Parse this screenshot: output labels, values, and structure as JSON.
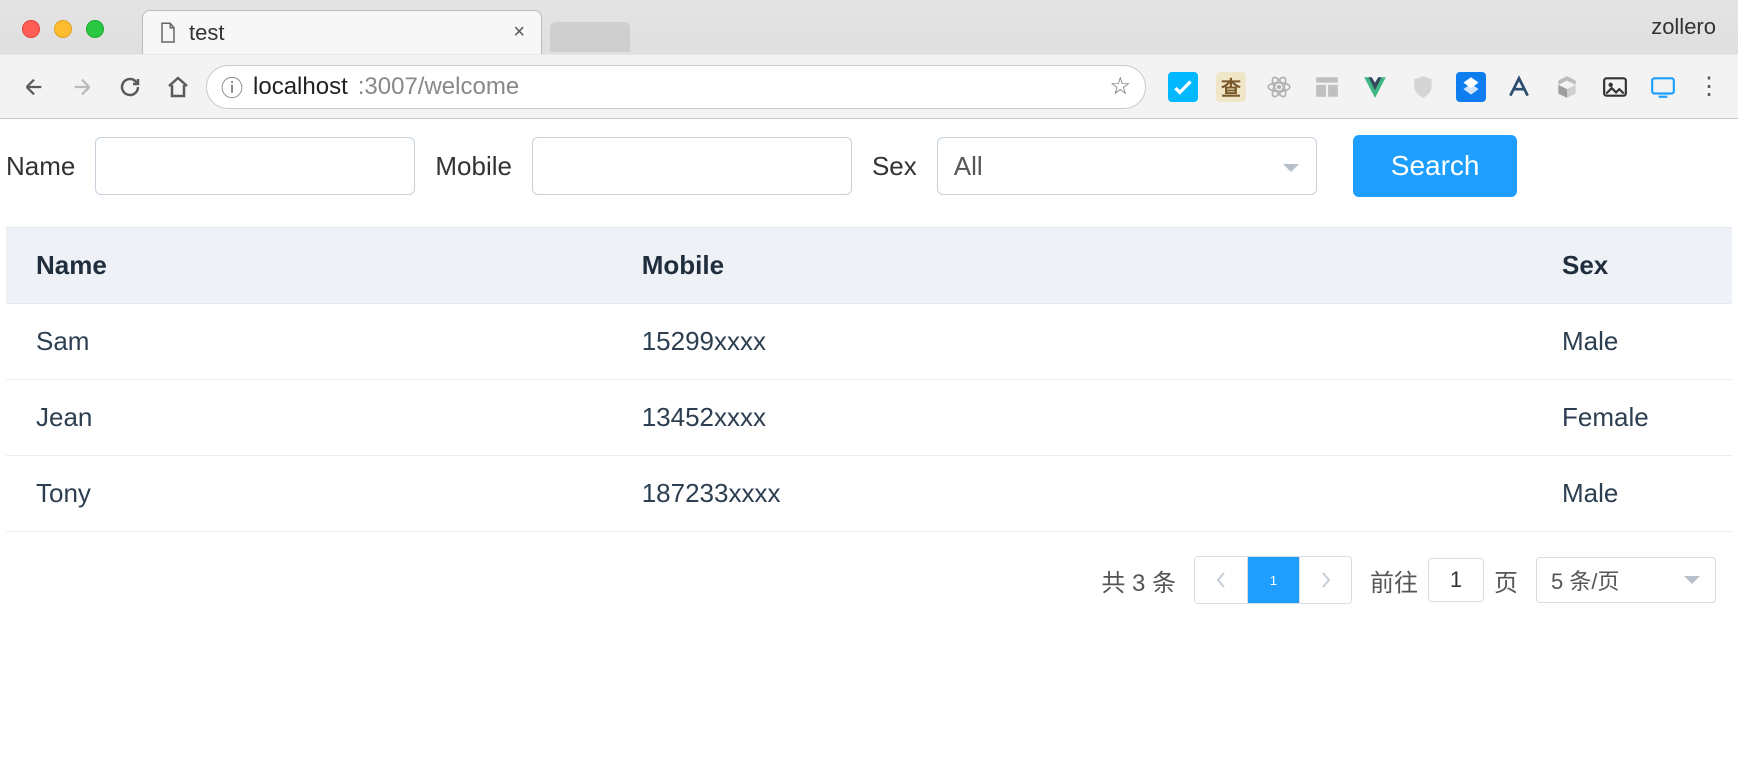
{
  "browser": {
    "tab_title": "test",
    "profile_name": "zollero",
    "url_host": "localhost",
    "url_rest": ":3007/welcome"
  },
  "filters": {
    "name_label": "Name",
    "name_value": "",
    "mobile_label": "Mobile",
    "mobile_value": "",
    "sex_label": "Sex",
    "sex_value": "All",
    "search_label": "Search"
  },
  "table": {
    "columns": [
      "Name",
      "Mobile",
      "Sex"
    ],
    "rows": [
      {
        "name": "Sam",
        "mobile": "15299xxxx",
        "sex": "Male"
      },
      {
        "name": "Jean",
        "mobile": "13452xxxx",
        "sex": "Female"
      },
      {
        "name": "Tony",
        "mobile": "187233xxxx",
        "sex": "Male"
      }
    ]
  },
  "pagination": {
    "total_text": "共 3 条",
    "current_page": "1",
    "goto_prefix": "前往",
    "goto_value": "1",
    "goto_suffix": "页",
    "page_size_label": "5 条/页"
  }
}
